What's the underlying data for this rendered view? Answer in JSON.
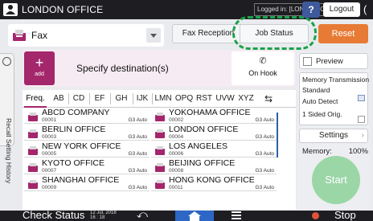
{
  "topbar": {
    "title": "LONDON OFFICE",
    "logged_in": "Logged in: [LONDON OFFICE]",
    "help_label": "?",
    "logout_label": "Logout",
    "extra_label": "("
  },
  "function": {
    "label": "Fax"
  },
  "buttons": {
    "fax_reception": "Fax Reception",
    "job_status": "Job Status",
    "reset": "Reset"
  },
  "sidebar": {
    "recall_label": "Recall Setting History"
  },
  "destination": {
    "add_label": "add",
    "add_symbol": "+",
    "specify_label": "Specify destination(s)",
    "on_hook_label": "On Hook"
  },
  "tabs": [
    "Freq.",
    "AB",
    "CD",
    "EF",
    "GH",
    "IJK",
    "LMN",
    "OPQ",
    "RST",
    "UVW",
    "XYZ"
  ],
  "destinations": [
    {
      "name": "ABCD COMPANY",
      "number": "00001",
      "mode": "G3 Auto"
    },
    {
      "name": "YOKOHAMA OFFICE",
      "number": "00002",
      "mode": "G3 Auto"
    },
    {
      "name": "BERLIN OFFICE",
      "number": "00003",
      "mode": "G3 Auto"
    },
    {
      "name": "LONDON OFFICE",
      "number": "00004",
      "mode": "G3 Auto"
    },
    {
      "name": "NEW YORK OFFICE",
      "number": "00005",
      "mode": "G3 Auto"
    },
    {
      "name": "LOS ANGELES",
      "number": "00006",
      "mode": "G3 Auto"
    },
    {
      "name": "KYOTO OFFICE",
      "number": "00007",
      "mode": "G3 Auto"
    },
    {
      "name": "BEIJING OFFICE",
      "number": "00008",
      "mode": "G3 Auto"
    },
    {
      "name": "SHANGHAI OFFICE",
      "number": "00009",
      "mode": "G3 Auto"
    },
    {
      "name": "HONG KONG OFFICE",
      "number": "00011",
      "mode": "G3 Auto"
    }
  ],
  "right_panel": {
    "preview_label": "Preview",
    "memory_transmission": "Memory Transmission",
    "standard": "Standard",
    "auto_detect": "Auto Detect",
    "sided": "1 Sided Orig.",
    "settings_label": "Settings",
    "memory_label": "Memory:",
    "memory_value": "100%",
    "start_label": "Start"
  },
  "bottombar": {
    "check_status": "Check Status",
    "date": "12 Jul. 2018",
    "time": "16 : 18",
    "stop_label": "Stop"
  },
  "colors": {
    "accent": "#a4266b",
    "reset": "#e77b35",
    "start": "#9bd6a7",
    "highlight": "#1aa24a",
    "home_active": "#2d66c4"
  }
}
